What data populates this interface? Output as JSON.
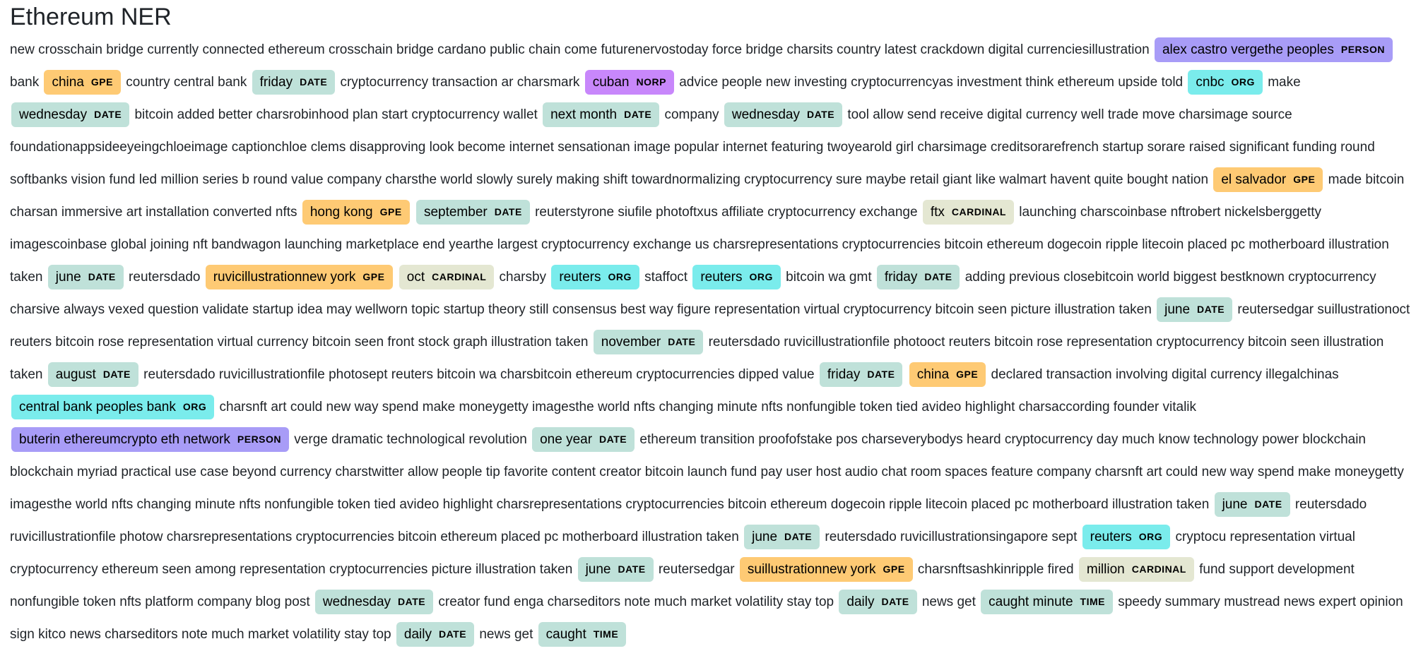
{
  "title": "Ethereum NER",
  "colors": {
    "PERSON": "#a89cf7",
    "GPE": "#feca74",
    "DATE": "#bfe1d9",
    "NORP": "#c887fb",
    "ORG": "#7aecec",
    "CARDINAL": "#e4e7d2",
    "TIME": "#bfe1d9"
  },
  "segments": [
    {
      "t": "new crosschain bridge currently connected ethereum crosschain bridge cardano public chain come futurenervostoday force bridge charsits country latest crackdown digital currenciesillustration"
    },
    {
      "e": "alex castro vergethe peoples",
      "l": "PERSON"
    },
    {
      "t": "bank"
    },
    {
      "e": "china",
      "l": "GPE"
    },
    {
      "t": "country central bank"
    },
    {
      "e": "friday",
      "l": "DATE"
    },
    {
      "t": "cryptocurrency transaction ar charsmark"
    },
    {
      "e": "cuban",
      "l": "NORP"
    },
    {
      "t": "advice people new investing cryptocurrencyas investment think ethereum upside told"
    },
    {
      "e": "cnbc",
      "l": "ORG"
    },
    {
      "t": "make"
    },
    {
      "e": "wednesday",
      "l": "DATE"
    },
    {
      "t": "bitcoin added better charsrobinhood plan start cryptocurrency wallet"
    },
    {
      "e": "next month",
      "l": "DATE"
    },
    {
      "t": "company"
    },
    {
      "e": "wednesday",
      "l": "DATE"
    },
    {
      "t": "tool allow send receive digital currency well trade move charsimage source foundationappsideeyeingchloeimage captionchloe clems disapproving look become internet sensationan image popular internet featuring twoyearold girl charsimage creditsorarefrench startup sorare raised significant funding round softbanks vision fund led million series b round value company charsthe world slowly surely making shift towardnormalizing cryptocurrency sure maybe retail giant like walmart havent quite bought nation"
    },
    {
      "e": "el salvador",
      "l": "GPE"
    },
    {
      "t": "made bitcoin charsan immersive art installation converted nfts"
    },
    {
      "e": "hong kong",
      "l": "GPE"
    },
    {
      "e": "september",
      "l": "DATE"
    },
    {
      "t": "reuterstyrone siufile photoftxus affiliate cryptocurrency exchange"
    },
    {
      "e": "ftx",
      "l": "CARDINAL"
    },
    {
      "t": "launching charscoinbase nftrobert nickelsberggetty imagescoinbase global joining nft bandwagon launching marketplace end yearthe largest cryptocurrency exchange us charsrepresentations cryptocurrencies bitcoin ethereum dogecoin ripple litecoin placed pc motherboard illustration taken"
    },
    {
      "e": "june",
      "l": "DATE"
    },
    {
      "t": "reutersdado"
    },
    {
      "e": "ruvicillustrationnew york",
      "l": "GPE"
    },
    {
      "e": "oct",
      "l": "CARDINAL"
    },
    {
      "t": "charsby"
    },
    {
      "e": "reuters",
      "l": "ORG"
    },
    {
      "t": "staffoct"
    },
    {
      "e": "reuters",
      "l": "ORG"
    },
    {
      "t": "bitcoin wa gmt"
    },
    {
      "e": "friday",
      "l": "DATE"
    },
    {
      "t": "adding previous closebitcoin world biggest bestknown cryptocurrency charsive always vexed question validate startup idea may wellworn topic startup theory still consensus best way figure representation virtual cryptocurrency bitcoin seen picture illustration taken"
    },
    {
      "e": "june",
      "l": "DATE"
    },
    {
      "t": "reutersedgar suillustrationoct reuters bitcoin rose representation virtual currency bitcoin seen front stock graph illustration taken"
    },
    {
      "e": "november",
      "l": "DATE"
    },
    {
      "t": "reutersdado ruvicillustrationfile photooct reuters bitcoin rose representation cryptocurrency bitcoin seen illustration taken"
    },
    {
      "e": "august",
      "l": "DATE"
    },
    {
      "t": "reutersdado ruvicillustrationfile photosept reuters bitcoin wa charsbitcoin ethereum cryptocurrencies dipped value"
    },
    {
      "e": "friday",
      "l": "DATE"
    },
    {
      "e": "china",
      "l": "GPE"
    },
    {
      "t": "declared transaction involving digital currency illegalchinas"
    },
    {
      "e": "central bank peoples bank",
      "l": "ORG"
    },
    {
      "t": "charsnft art could new way spend make moneygetty imagesthe world nfts changing minute nfts nonfungible token tied avideo highlight charsaccording founder vitalik"
    },
    {
      "e": "buterin ethereumcrypto eth network",
      "l": "PERSON"
    },
    {
      "t": "verge dramatic technological revolution"
    },
    {
      "e": "one year",
      "l": "DATE"
    },
    {
      "t": "ethereum transition proofofstake pos charseverybodys heard cryptocurrency day much know technology power blockchain blockchain myriad practical use case beyond currency charstwitter allow people tip favorite content creator bitcoin launch fund pay user host audio chat room spaces feature company charsnft art could new way spend make moneygetty imagesthe world nfts changing minute nfts nonfungible token tied avideo highlight charsrepresentations cryptocurrencies bitcoin ethereum dogecoin ripple litecoin placed pc motherboard illustration taken"
    },
    {
      "e": "june",
      "l": "DATE"
    },
    {
      "t": "reutersdado ruvicillustrationfile photow charsrepresentations cryptocurrencies bitcoin ethereum placed pc motherboard illustration taken"
    },
    {
      "e": "june",
      "l": "DATE"
    },
    {
      "t": "reutersdado ruvicillustrationsingapore sept"
    },
    {
      "e": "reuters",
      "l": "ORG"
    },
    {
      "t": "cryptocu representation virtual cryptocurrency ethereum seen among representation cryptocurrencies picture illustration taken"
    },
    {
      "e": "june",
      "l": "DATE"
    },
    {
      "t": "reutersedgar"
    },
    {
      "e": "suillustrationnew york",
      "l": "GPE"
    },
    {
      "t": "charsnftsashkinripple fired"
    },
    {
      "e": "million",
      "l": "CARDINAL"
    },
    {
      "t": "fund support development nonfungible token nfts platform company blog post"
    },
    {
      "e": "wednesday",
      "l": "DATE"
    },
    {
      "t": "creator fund enga charseditors note much market volatility stay top"
    },
    {
      "e": "daily",
      "l": "DATE"
    },
    {
      "t": "news get"
    },
    {
      "e": "caught minute",
      "l": "TIME"
    },
    {
      "t": "speedy summary mustread news expert opinion sign kitco news charseditors note much market volatility stay top"
    },
    {
      "e": "daily",
      "l": "DATE"
    },
    {
      "t": "news get"
    },
    {
      "e": "caught",
      "l": "TIME"
    }
  ]
}
